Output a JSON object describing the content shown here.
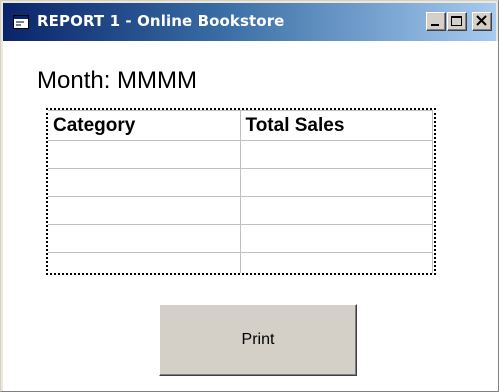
{
  "window": {
    "title": "REPORT 1 - Online Bookstore",
    "app_icon": "form-window-icon",
    "controls": {
      "minimize_icon": "minimize-icon",
      "maximize_icon": "maximize-icon",
      "close_icon": "close-icon"
    },
    "colors": {
      "titlebar_start": "#0a246a",
      "titlebar_end": "#a6caf0",
      "button_face": "#d4d0c8"
    }
  },
  "report": {
    "month_label": "Month: MMMM",
    "table": {
      "columns": [
        "Category",
        "Total Sales"
      ],
      "rows": [
        [
          "",
          ""
        ],
        [
          "",
          ""
        ],
        [
          "",
          ""
        ],
        [
          "",
          ""
        ],
        [
          "",
          ""
        ]
      ]
    },
    "print_label": "Print"
  }
}
